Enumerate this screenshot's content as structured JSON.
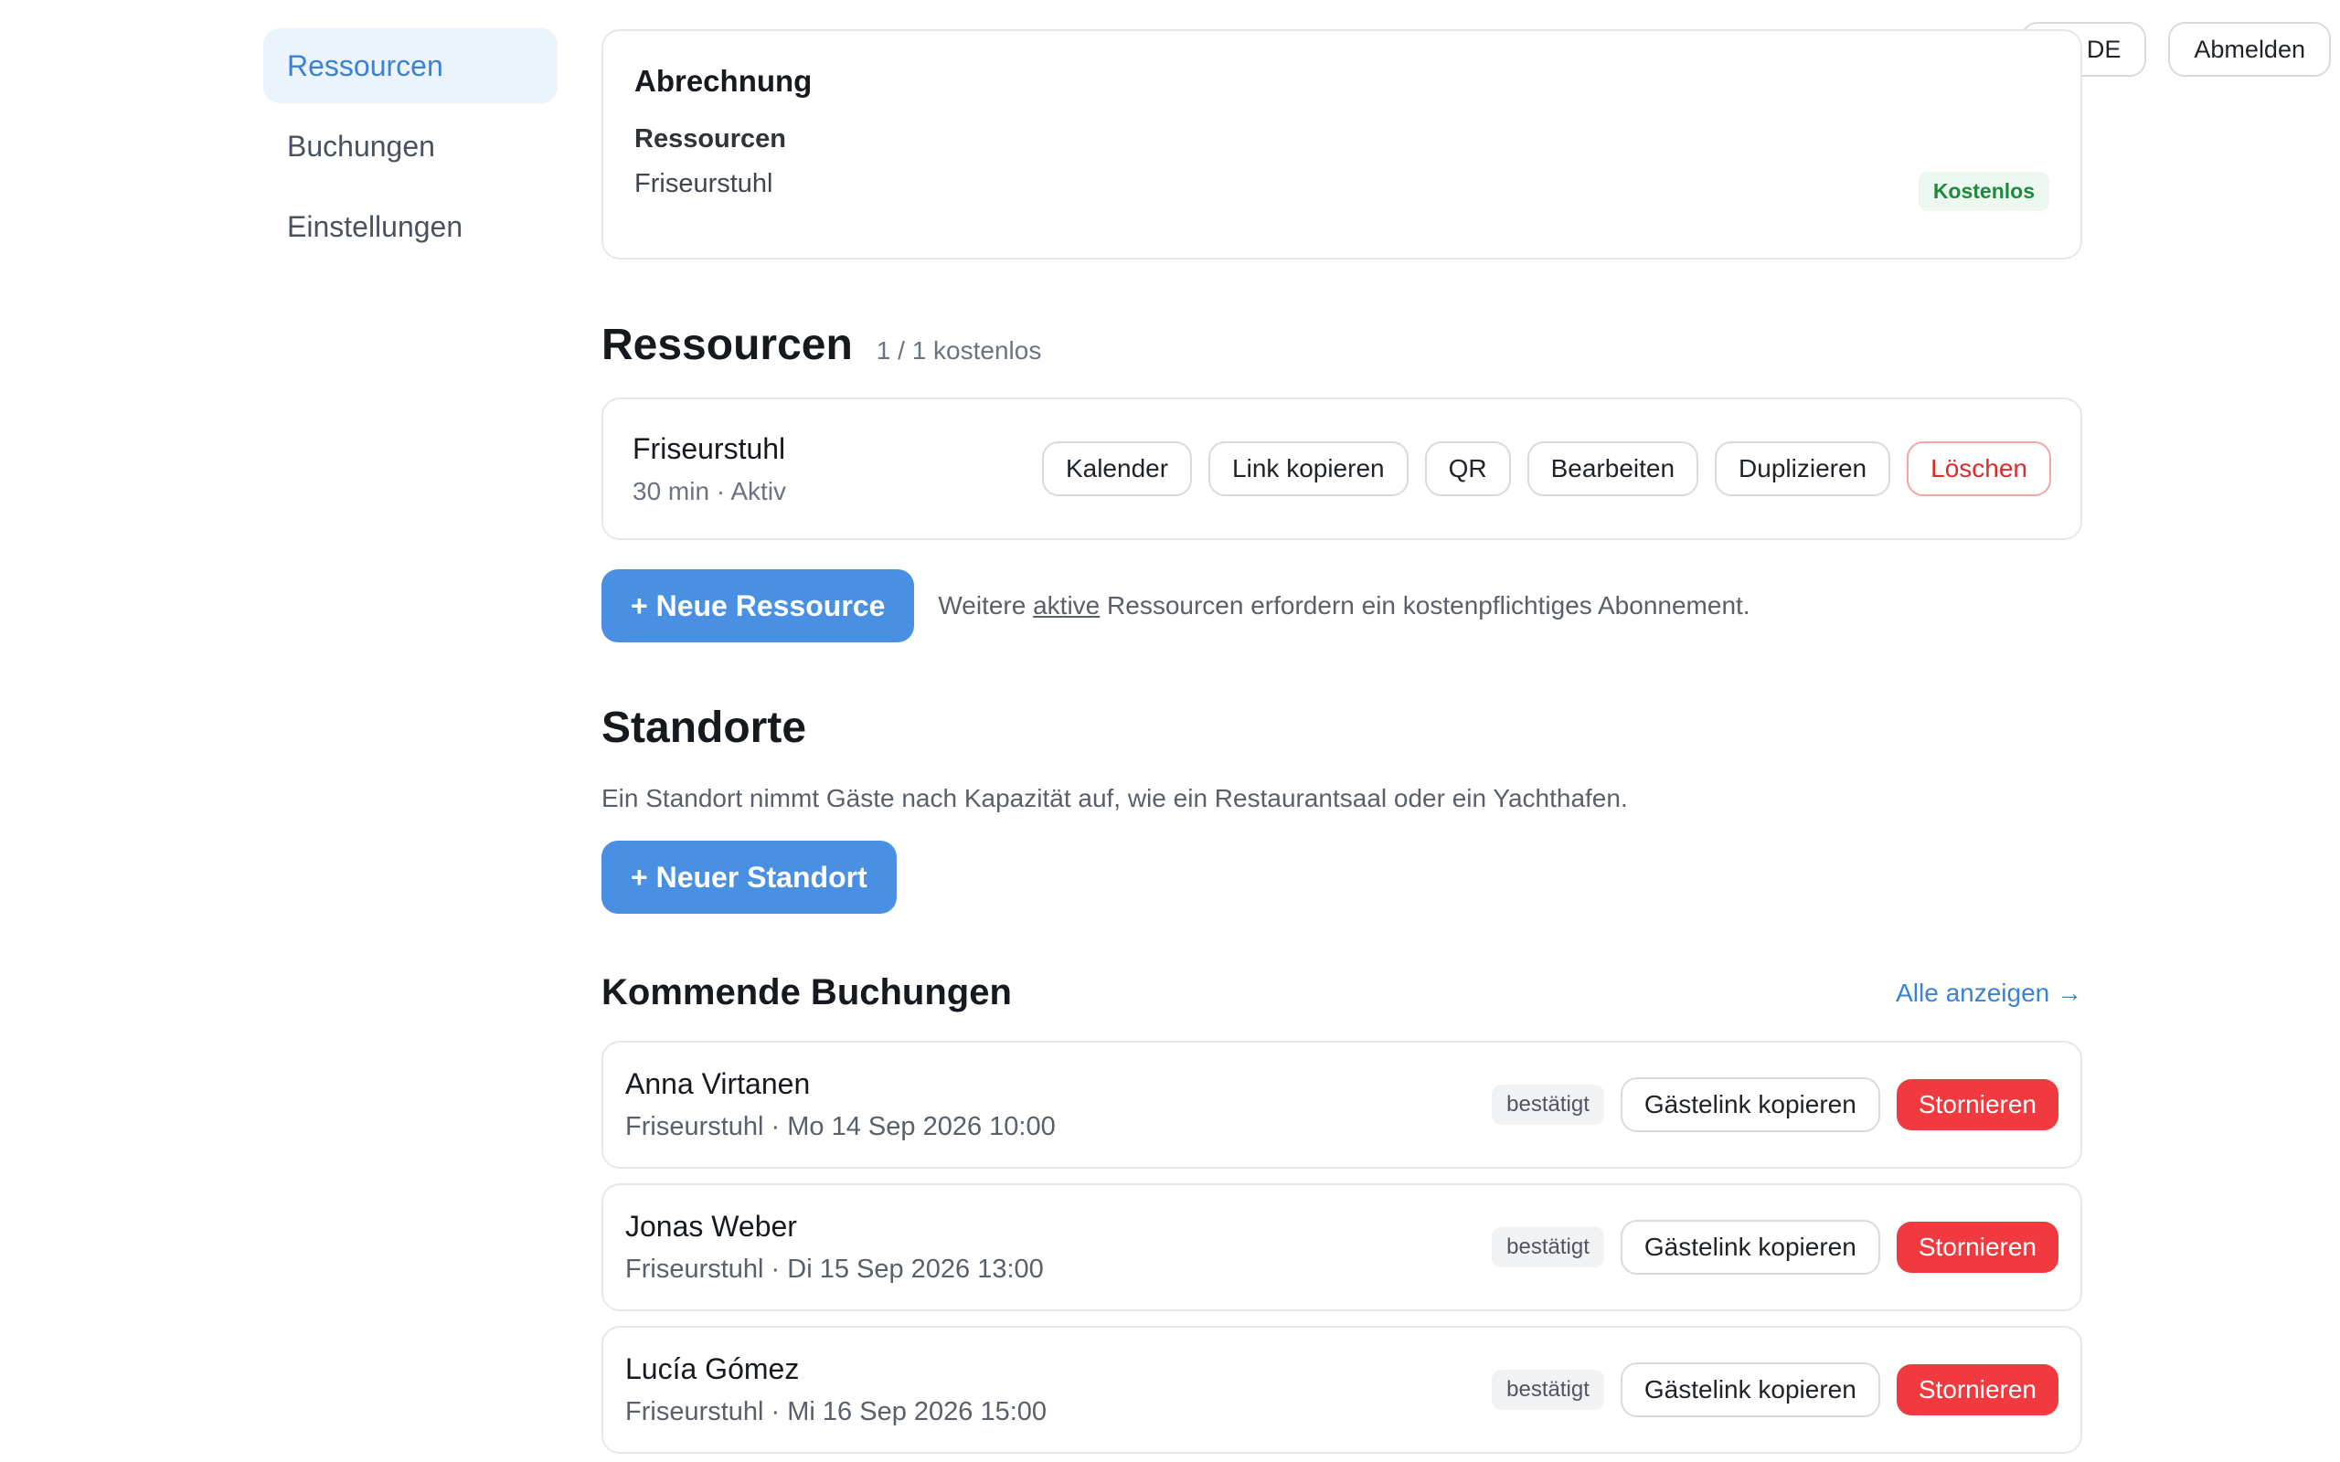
{
  "header": {
    "language": "DE",
    "logout_label": "Abmelden"
  },
  "sidebar": {
    "items": [
      {
        "label": "Ressourcen",
        "active": true
      },
      {
        "label": "Buchungen",
        "active": false
      },
      {
        "label": "Einstellungen",
        "active": false
      }
    ]
  },
  "billing": {
    "title": "Abrechnung",
    "subtitle": "Ressourcen",
    "resource_name": "Friseurstuhl",
    "plan_badge": "Kostenlos"
  },
  "resources": {
    "title": "Ressourcen",
    "count_text": "1 / 1 kostenlos",
    "items": [
      {
        "name": "Friseurstuhl",
        "meta": "30 min · Aktiv",
        "actions": {
          "calendar": "Kalender",
          "copy_link": "Link kopieren",
          "qr": "QR",
          "edit": "Bearbeiten",
          "duplicate": "Duplizieren",
          "delete": "Löschen"
        }
      }
    ],
    "new_button": "+ Neue Ressource",
    "hint_before": "Weitere ",
    "hint_link": "aktive",
    "hint_after": " Ressourcen erfordern ein kostenpflichtiges Abonnement."
  },
  "locations": {
    "title": "Standorte",
    "description": "Ein Standort nimmt Gäste nach Kapazität auf, wie ein Restaurantsaal oder ein Yachthafen.",
    "new_button": "+ Neuer Standort"
  },
  "bookings": {
    "title": "Kommende Buchungen",
    "show_all": "Alle anzeigen →",
    "items": [
      {
        "guest": "Anna Virtanen",
        "details": "Friseurstuhl · Mo 14 Sep 2026 10:00",
        "status": "bestätigt",
        "copy_label": "Gästelink kopieren",
        "cancel_label": "Stornieren"
      },
      {
        "guest": "Jonas Weber",
        "details": "Friseurstuhl · Di 15 Sep 2026 13:00",
        "status": "bestätigt",
        "copy_label": "Gästelink kopieren",
        "cancel_label": "Stornieren"
      },
      {
        "guest": "Lucía Gómez",
        "details": "Friseurstuhl · Mi 16 Sep 2026 15:00",
        "status": "bestätigt",
        "copy_label": "Gästelink kopieren",
        "cancel_label": "Stornieren"
      }
    ]
  },
  "colors": {
    "accent": "#4a90e2",
    "danger": "#f13a3f",
    "success": "#1f8a3e"
  }
}
